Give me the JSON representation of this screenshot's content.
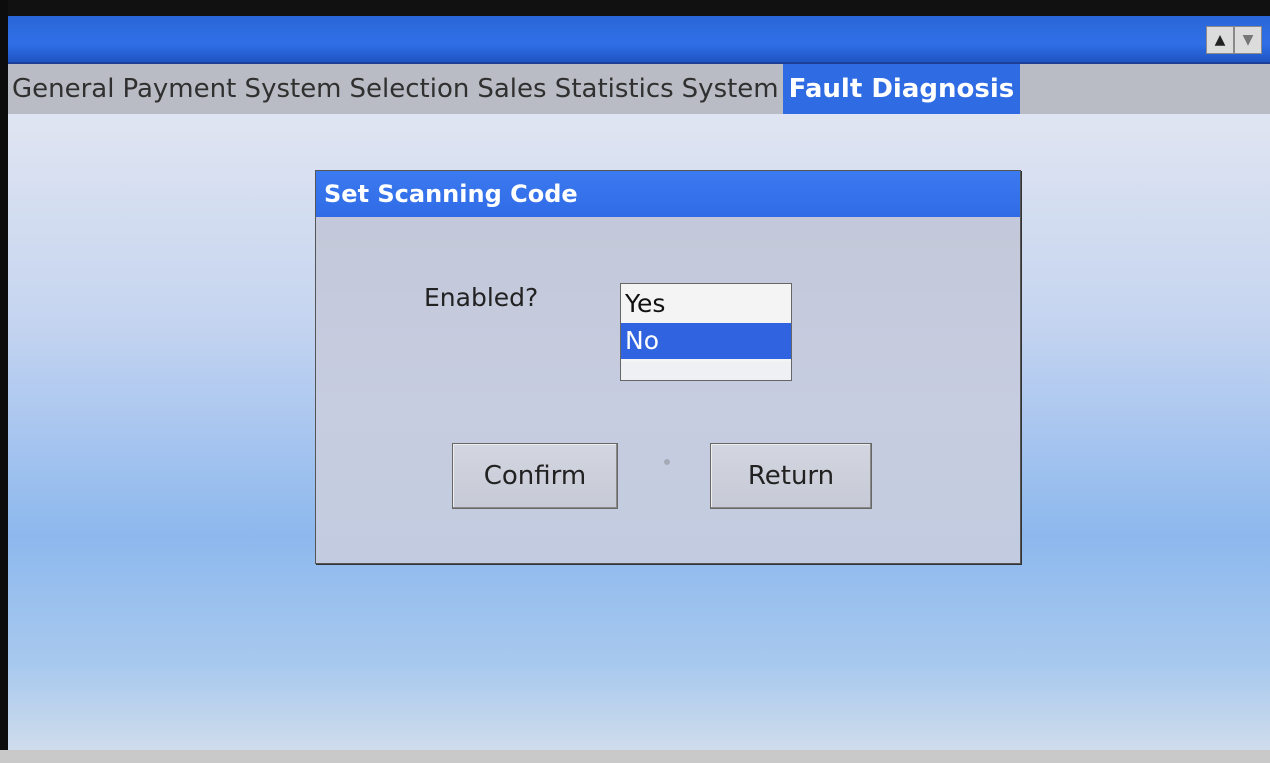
{
  "header": {
    "scroll_up_icon": "triangle-up-icon",
    "scroll_down_icon": "triangle-down-icon",
    "scroll_up_glyph": "▲",
    "scroll_down_glyph": "▼"
  },
  "tabs": [
    {
      "label": "General",
      "active": false
    },
    {
      "label": "Payment System",
      "active": false
    },
    {
      "label": "Selection",
      "active": false
    },
    {
      "label": "Sales Statistics",
      "active": false
    },
    {
      "label": "System",
      "active": false
    },
    {
      "label": "Fault Diagnosis",
      "active": true
    }
  ],
  "dialog": {
    "title": "Set Scanning Code",
    "enabled_label": "Enabled?",
    "options": [
      "Yes",
      "No"
    ],
    "selected": "No",
    "confirm_label": "Confirm",
    "return_label": "Return"
  },
  "colors": {
    "accent": "#2f6be3",
    "selection": "#2f63e0",
    "tab_bar": "#b9bcc4"
  }
}
